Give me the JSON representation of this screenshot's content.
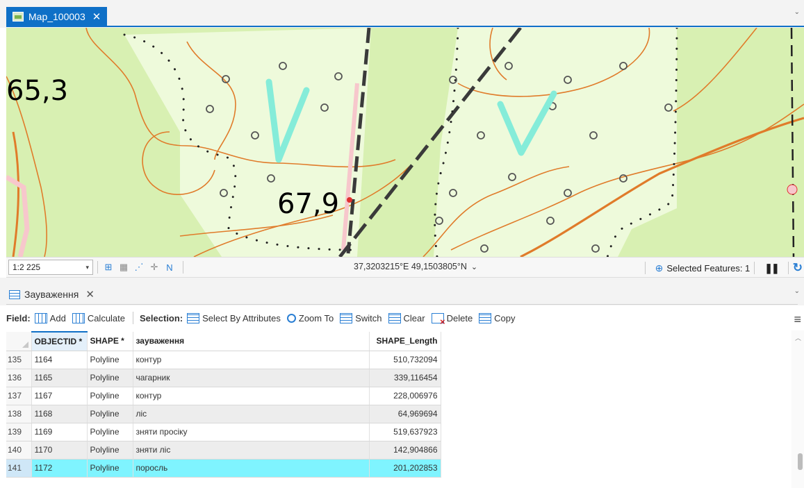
{
  "map_tab": {
    "title": "Map_100003",
    "close": "✕"
  },
  "map": {
    "labels": {
      "spot_a": "65,3",
      "spot_b": "67,9"
    },
    "colors": {
      "background": "#d8f0b2",
      "forest": "#eefadb",
      "contour": "#e07b2a",
      "road": "#3a3a3a",
      "mark": "#85ecd9"
    }
  },
  "statusbar": {
    "scale": "1:2 225",
    "coordinates": "37,3203215°E 49,1503805°N",
    "selected_features": "Selected Features: 1"
  },
  "table_tab": {
    "title": "Зауваження",
    "close": "✕"
  },
  "toolbar": {
    "field_label": "Field:",
    "add": "Add",
    "calculate": "Calculate",
    "selection_label": "Selection:",
    "select_by_attributes": "Select By Attributes",
    "zoom_to": "Zoom To",
    "switch": "Switch",
    "clear": "Clear",
    "delete": "Delete",
    "copy": "Copy"
  },
  "table": {
    "columns": [
      "OBJECTID *",
      "SHAPE *",
      "зауваження",
      "SHAPE_Length"
    ],
    "rows": [
      {
        "n": "135",
        "id": "1164",
        "shape": "Polyline",
        "note": "контур",
        "length": "510,732094"
      },
      {
        "n": "136",
        "id": "1165",
        "shape": "Polyline",
        "note": "чагарник",
        "length": "339,116454"
      },
      {
        "n": "137",
        "id": "1167",
        "shape": "Polyline",
        "note": "контур",
        "length": "228,006976"
      },
      {
        "n": "138",
        "id": "1168",
        "shape": "Polyline",
        "note": "ліс",
        "length": "64,969694"
      },
      {
        "n": "139",
        "id": "1169",
        "shape": "Polyline",
        "note": "зняти просіку",
        "length": "519,637923"
      },
      {
        "n": "140",
        "id": "1170",
        "shape": "Polyline",
        "note": "зняти ліс",
        "length": "142,904866"
      },
      {
        "n": "141",
        "id": "1172",
        "shape": "Polyline",
        "note": "поросль",
        "length": "201,202853"
      }
    ],
    "selected_row": "141"
  }
}
